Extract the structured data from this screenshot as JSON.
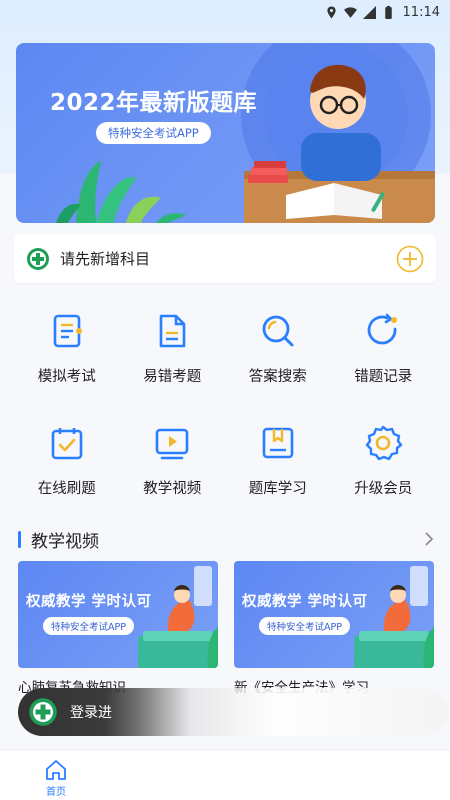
{
  "status_bar": {
    "time": "11:14"
  },
  "banner": {
    "title": "2022年最新版题库",
    "subtitle": "特种安全考试APP",
    "dots": 2,
    "active_dot": 0
  },
  "subject_bar": {
    "label": "请先新增科目"
  },
  "grid": {
    "items": [
      {
        "label": "模拟考试",
        "icon": "exam-list-icon"
      },
      {
        "label": "易错考题",
        "icon": "document-icon"
      },
      {
        "label": "答案搜索",
        "icon": "search-icon"
      },
      {
        "label": "错题记录",
        "icon": "refresh-icon"
      },
      {
        "label": "在线刷题",
        "icon": "calendar-check-icon"
      },
      {
        "label": "教学视频",
        "icon": "play-video-icon"
      },
      {
        "label": "题库学习",
        "icon": "bookmark-folder-icon"
      },
      {
        "label": "升级会员",
        "icon": "gear-icon"
      }
    ]
  },
  "section": {
    "title": "教学视频"
  },
  "videos": [
    {
      "thumb_title": "权威教学 学时认可",
      "thumb_pill": "特种安全考试APP",
      "caption": "心肺复苏急救知识"
    },
    {
      "thumb_title": "权威教学 学时认可",
      "thumb_pill": "特种安全考试APP",
      "caption": "新《安全生产法》学习"
    }
  ],
  "toast": {
    "text": "登录进"
  },
  "bottom_nav": {
    "home_label": "首页"
  },
  "colors": {
    "accent": "#2a7fff",
    "banner": "#5c88f2",
    "add": "#f2b82a",
    "logo_green": "#1f9d55"
  }
}
